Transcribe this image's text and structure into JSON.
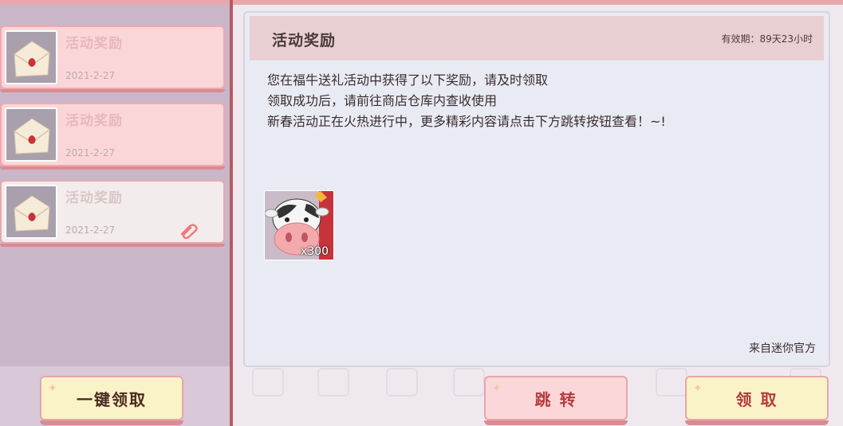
{
  "colors": {
    "accent_pink": "#fbd6d8",
    "header_bg": "#e9cfd2",
    "card_bg": "#e9ebf4",
    "claim_text": "#b53a3c"
  },
  "mail_list": [
    {
      "title": "活动奖励",
      "date": "2021-2-27",
      "state": "unread",
      "icon": "envelope-icon"
    },
    {
      "title": "活动奖励",
      "date": "2021-2-27",
      "state": "unread",
      "icon": "envelope-icon"
    },
    {
      "title": "活动奖励",
      "date": "2021-2-27",
      "state": "read",
      "icon": "envelope-icon",
      "attachment_icon": "paperclip-icon"
    }
  ],
  "message": {
    "title": "活动奖励",
    "expire": "有效期：89天23小时",
    "body_lines": [
      "您在福牛送礼活动中获得了以下奖励，请及时领取",
      "领取成功后，请前往商店仓库内查收使用",
      "新春活动正在火热进行中，更多精彩内容请点击下方跳转按钮查看！~!"
    ],
    "reward": {
      "icon": "cow-icon",
      "quantity": "x300"
    },
    "from": "来自迷你官方"
  },
  "buttons": {
    "claim_all": "一键领取",
    "jump": "跳 转",
    "claim": "领 取"
  }
}
